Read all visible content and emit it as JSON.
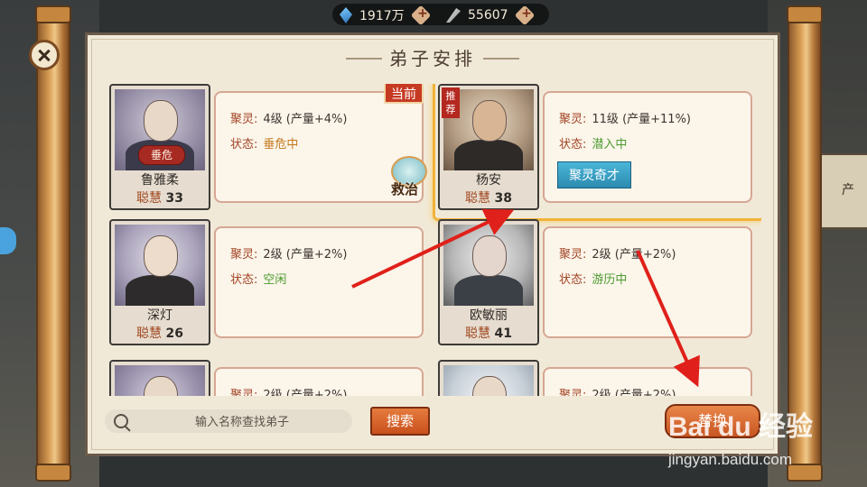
{
  "resources": {
    "jade": "1917万",
    "feather": "55607"
  },
  "title": "弟子安排",
  "labels": {
    "spirit": "聚灵:",
    "status": "状态:",
    "wisdom": "聪慧"
  },
  "cards": [
    {
      "name": "鲁雅柔",
      "wisdom": "33",
      "spirit": "4级 (产量+4%)",
      "status": "垂危中",
      "badge": "垂危",
      "tag": "当前",
      "action": "救治"
    },
    {
      "name": "杨安",
      "wisdom": "38",
      "spirit": "11级 (产量+11%)",
      "status": "潜入中",
      "tag": "推荐",
      "action": "聚灵奇才"
    },
    {
      "name": "深灯",
      "wisdom": "26",
      "spirit": "2级 (产量+2%)",
      "status": "空闲"
    },
    {
      "name": "欧敏丽",
      "wisdom": "41",
      "spirit": "2级 (产量+2%)",
      "status": "游历中"
    },
    {
      "spirit": "2级 (产量+2%)"
    },
    {
      "spirit": "2级 (产量+2%)"
    }
  ],
  "search": {
    "placeholder": "输入名称查找弟子",
    "button": "搜索"
  },
  "replace_button": "替换",
  "side_panel_text": "产",
  "watermark": {
    "logo": "Bai du 经验",
    "url": "jingyan.baidu.com"
  },
  "colors": {
    "accent_orange": "#c9501d",
    "highlight_gold": "#f0b33a",
    "status_ok": "#4c9a2e",
    "status_warn": "#c4781a",
    "skill_blue": "#2c8bb0"
  }
}
